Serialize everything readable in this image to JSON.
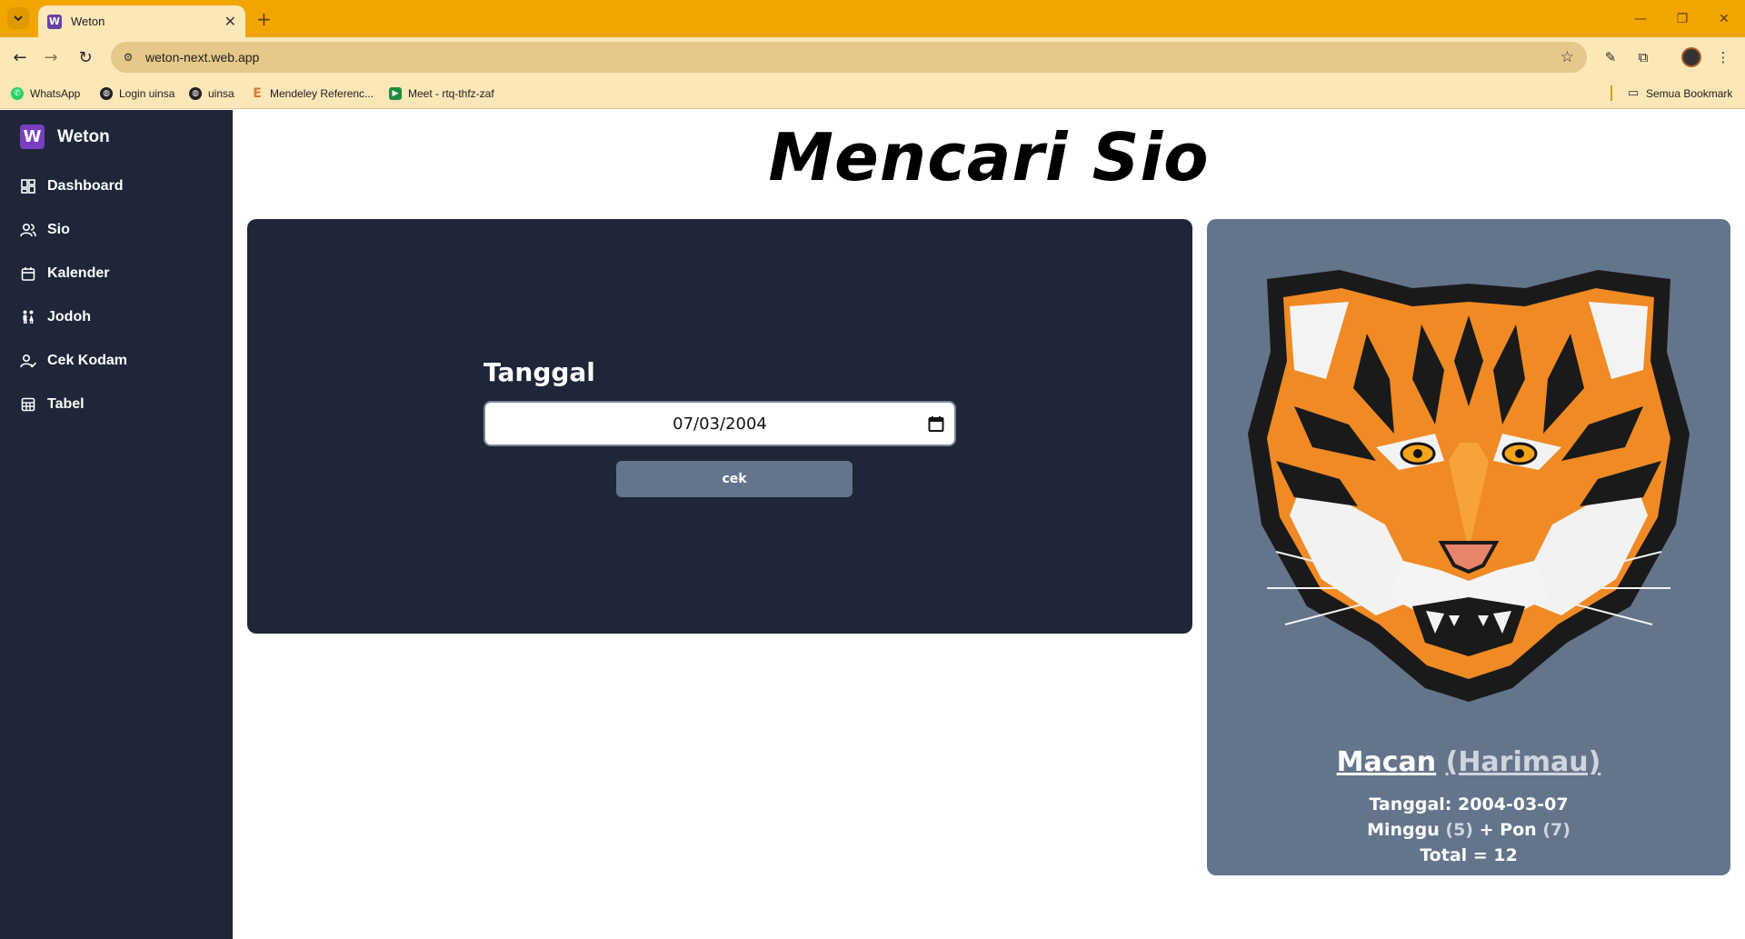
{
  "browser": {
    "tab_title": "Weton",
    "tab_favicon_letter": "W",
    "url": "weton-next.web.app",
    "bookmarks": [
      {
        "label": "WhatsApp",
        "icon": "whatsapp-icon"
      },
      {
        "label": "Login uinsa",
        "icon": "globe-icon"
      },
      {
        "label": "uinsa",
        "icon": "globe-icon"
      },
      {
        "label": "Mendeley Referenc...",
        "icon": "mendeley-icon"
      },
      {
        "label": "Meet - rtq-thfz-zaf",
        "icon": "meet-icon"
      }
    ],
    "all_bookmarks_label": "Semua Bookmark",
    "colors": {
      "tabbar": "#f2a500",
      "toolbar": "#fbe7b8"
    }
  },
  "sidebar": {
    "brand_letter": "W",
    "brand": "Weton",
    "items": [
      {
        "label": "Dashboard",
        "icon": "dashboard-icon"
      },
      {
        "label": "Sio",
        "icon": "users-icon"
      },
      {
        "label": "Kalender",
        "icon": "calendar-icon"
      },
      {
        "label": "Jodoh",
        "icon": "couple-icon"
      },
      {
        "label": "Cek Kodam",
        "icon": "user-check-icon"
      },
      {
        "label": "Tabel",
        "icon": "table-icon"
      }
    ],
    "colors": {
      "background": "#1e2638"
    }
  },
  "main": {
    "title": "Mencari Sio",
    "form": {
      "label": "Tanggal",
      "date_value": "07/03/2004",
      "button": "cek"
    },
    "result": {
      "sio_name": "Macan",
      "sio_translation": "(Harimau)",
      "image": "tiger-illustration",
      "date_label": "Tanggal:",
      "date": "2004-03-07",
      "day": "Minggu",
      "day_value": "(5)",
      "pasaran": "Pon",
      "pasaran_value": "(7)",
      "total_label": "Total = 12"
    },
    "colors": {
      "card": "#1e2638",
      "result_card": "#64748b",
      "button": "#64748b"
    }
  }
}
